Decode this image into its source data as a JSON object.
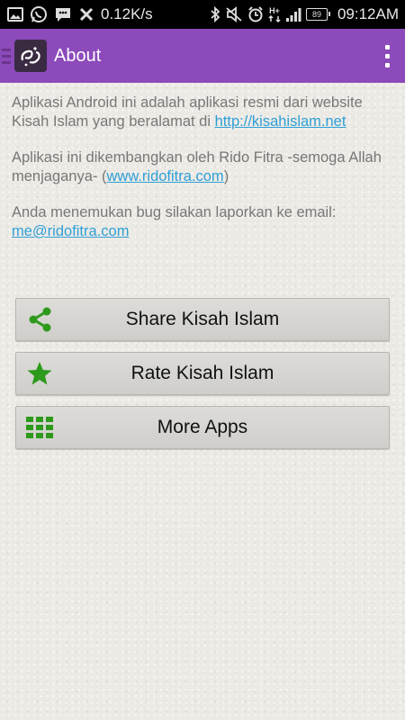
{
  "status_bar": {
    "network_speed": "0.12K/s",
    "battery_level": "89",
    "time": "09:12AM",
    "icons": [
      "image-icon",
      "whatsapp-icon",
      "bbm-icon",
      "tools-icon",
      "bluetooth-icon",
      "mute-icon",
      "alarm-icon",
      "hplus-signal-icon",
      "signal-icon",
      "battery-icon"
    ]
  },
  "action_bar": {
    "title": "About",
    "color": "#8c4aba"
  },
  "content": {
    "para1_text": "Aplikasi Android ini adalah aplikasi resmi dari website Kisah Islam yang beralamat di ",
    "para1_link": "http://kisahislam.net",
    "para2_text": "Aplikasi ini dikembangkan oleh Rido Fitra -semoga Allah menjaganya- (",
    "para2_link": "www.ridofitra.com",
    "para2_tail": ")",
    "para3_text": "Anda menemukan bug silakan laporkan ke email: ",
    "para3_link": "me@ridofitra.com"
  },
  "buttons": [
    {
      "label": "Share Kisah Islam",
      "icon": "share-icon"
    },
    {
      "label": "Rate Kisah Islam",
      "icon": "star-icon"
    },
    {
      "label": "More Apps",
      "icon": "grid-icon"
    }
  ],
  "accent_green": "#2d9a1b"
}
